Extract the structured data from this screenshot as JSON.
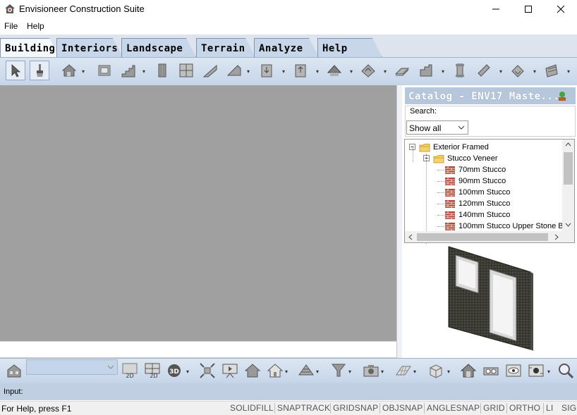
{
  "window": {
    "title": "Envisioneer Construction Suite"
  },
  "menu": {
    "items": [
      "File",
      "Help"
    ]
  },
  "tabs": [
    "Building",
    "Interiors",
    "Landscape",
    "Terrain",
    "Analyze",
    "Help"
  ],
  "active_tab": "Building",
  "catalog": {
    "title": "Catalog - ENV17 Maste...",
    "search_label": "Search:",
    "filter_value": "Show all",
    "tree": [
      {
        "label": "Exterior Framed",
        "level": 0,
        "type": "folder"
      },
      {
        "label": "Stucco Veneer",
        "level": 1,
        "type": "folder"
      },
      {
        "label": "70mm Stucco",
        "level": 2,
        "type": "item"
      },
      {
        "label": "90mm Stucco",
        "level": 2,
        "type": "item"
      },
      {
        "label": "100mm Stucco",
        "level": 2,
        "type": "item"
      },
      {
        "label": "120mm Stucco",
        "level": 2,
        "type": "item"
      },
      {
        "label": "140mm Stucco",
        "level": 2,
        "type": "item"
      },
      {
        "label": "100mm Stucco Upper Stone B",
        "level": 2,
        "type": "item"
      }
    ]
  },
  "bottom_toolbar": {
    "btn_2d": "2D",
    "btn_2d_2": "2D",
    "btn_3d": "3D"
  },
  "input_label": "Input:",
  "status": {
    "help_text": "For Help, press F1",
    "flags": [
      "SOLIDFILL",
      "SNAPTRACK",
      "GRIDSNAP",
      "OBJSNAP",
      "ANGLESNAP",
      "GRID",
      "ORTHO",
      "LI",
      "SIG"
    ]
  },
  "colors": {
    "accent": "#c5d5e9",
    "canvas": "#a0a0a0",
    "stucco_icon": "#b34a3a"
  }
}
